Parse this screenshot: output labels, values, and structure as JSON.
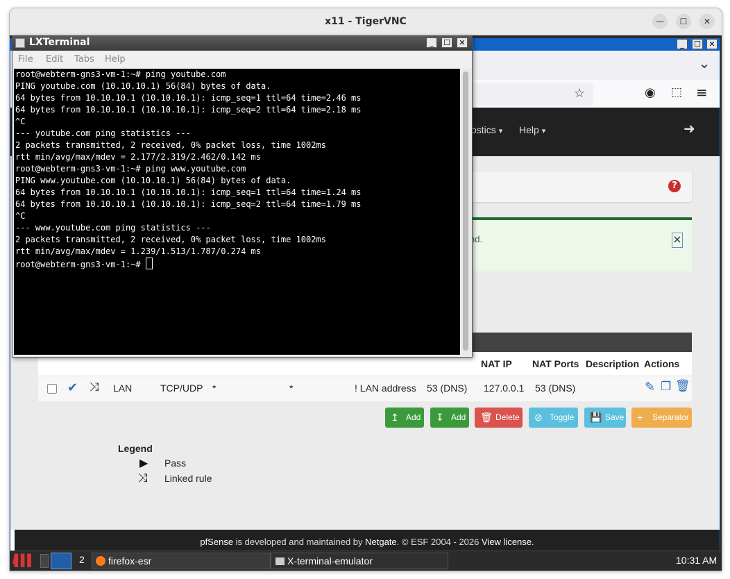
{
  "vnc": {
    "title": "x11 - TigerVNC",
    "btn_minimize": "—",
    "btn_maximize": "☐",
    "btn_close": "✕"
  },
  "firefox": {
    "win_btn_min": "_",
    "win_btn_max": "☐",
    "win_btn_close": "✕",
    "tabs_dropdown": "⌄",
    "star_icon": "☆",
    "account_icon": "◉",
    "extensions_icon": "⬚",
    "menu_icon": "≡"
  },
  "pfsense": {
    "nav": [
      {
        "label": "ostics"
      },
      {
        "label": "Help"
      }
    ],
    "nav_caret": "▾",
    "logout_icon": "➜",
    "help_icon": "?",
    "alert_text": "nd.",
    "alert_close": "×",
    "table": {
      "headers": [
        "NAT IP",
        "NAT Ports",
        "Description",
        "Actions"
      ],
      "row": {
        "interface": "LAN",
        "protocol": "TCP/UDP",
        "source_address": "*",
        "source_ports": "*",
        "dest_address": "! LAN address",
        "dest_ports": "53 (DNS)",
        "nat_ip": "127.0.0.1",
        "nat_ports": "53 (DNS)",
        "description": ""
      }
    },
    "buttons": [
      {
        "label": "Add",
        "icon": "↥",
        "color": "#3c9a3c"
      },
      {
        "label": "Add",
        "icon": "↧",
        "color": "#3c9a3c"
      },
      {
        "label": "Delete",
        "icon": "🗑",
        "color": "#d9534f"
      },
      {
        "label": "Toggle",
        "icon": "⊘",
        "color": "#5bc0de"
      },
      {
        "label": "Save",
        "icon": "💾",
        "color": "#5bc0de"
      },
      {
        "label": "Separator",
        "icon": "+",
        "color": "#f0ad4e"
      }
    ],
    "legend": {
      "title": "Legend",
      "items": [
        {
          "icon": "▶",
          "label": "Pass"
        },
        {
          "icon": "⤨",
          "label": "Linked rule"
        }
      ]
    },
    "footer": {
      "brand": "pfSense",
      "text1": " is developed and maintained by ",
      "company": "Netgate",
      "text2": ". © ESF 2004 - 2026 ",
      "license": "View license."
    }
  },
  "lxterminal": {
    "title": "LXTerminal",
    "btn_min": "_",
    "btn_max": "☐",
    "btn_close": "✕",
    "menu": [
      "File",
      "Edit",
      "Tabs",
      "Help"
    ],
    "lines": [
      "root@webterm-gns3-vm-1:~# ping youtube.com",
      "PING youtube.com (10.10.10.1) 56(84) bytes of data.",
      "64 bytes from 10.10.10.1 (10.10.10.1): icmp_seq=1 ttl=64 time=2.46 ms",
      "64 bytes from 10.10.10.1 (10.10.10.1): icmp_seq=2 ttl=64 time=2.18 ms",
      "^C",
      "--- youtube.com ping statistics ---",
      "2 packets transmitted, 2 received, 0% packet loss, time 1002ms",
      "rtt min/avg/max/mdev = 2.177/2.319/2.462/0.142 ms",
      "root@webterm-gns3-vm-1:~# ping www.youtube.com",
      "PING www.youtube.com (10.10.10.1) 56(84) bytes of data.",
      "64 bytes from 10.10.10.1 (10.10.10.1): icmp_seq=1 ttl=64 time=1.24 ms",
      "64 bytes from 10.10.10.1 (10.10.10.1): icmp_seq=2 ttl=64 time=1.79 ms",
      "^C",
      "--- www.youtube.com ping statistics ---",
      "2 packets transmitted, 2 received, 0% packet loss, time 1002ms",
      "rtt min/avg/max/mdev = 1.239/1.513/1.787/0.274 ms"
    ],
    "prompt": "root@webterm-gns3-vm-1:~# "
  },
  "taskbar": {
    "desktop_number": "2",
    "tasks": [
      {
        "label": "firefox-esr"
      },
      {
        "label": "X-terminal-emulator"
      }
    ],
    "clock": "10:31 AM"
  }
}
